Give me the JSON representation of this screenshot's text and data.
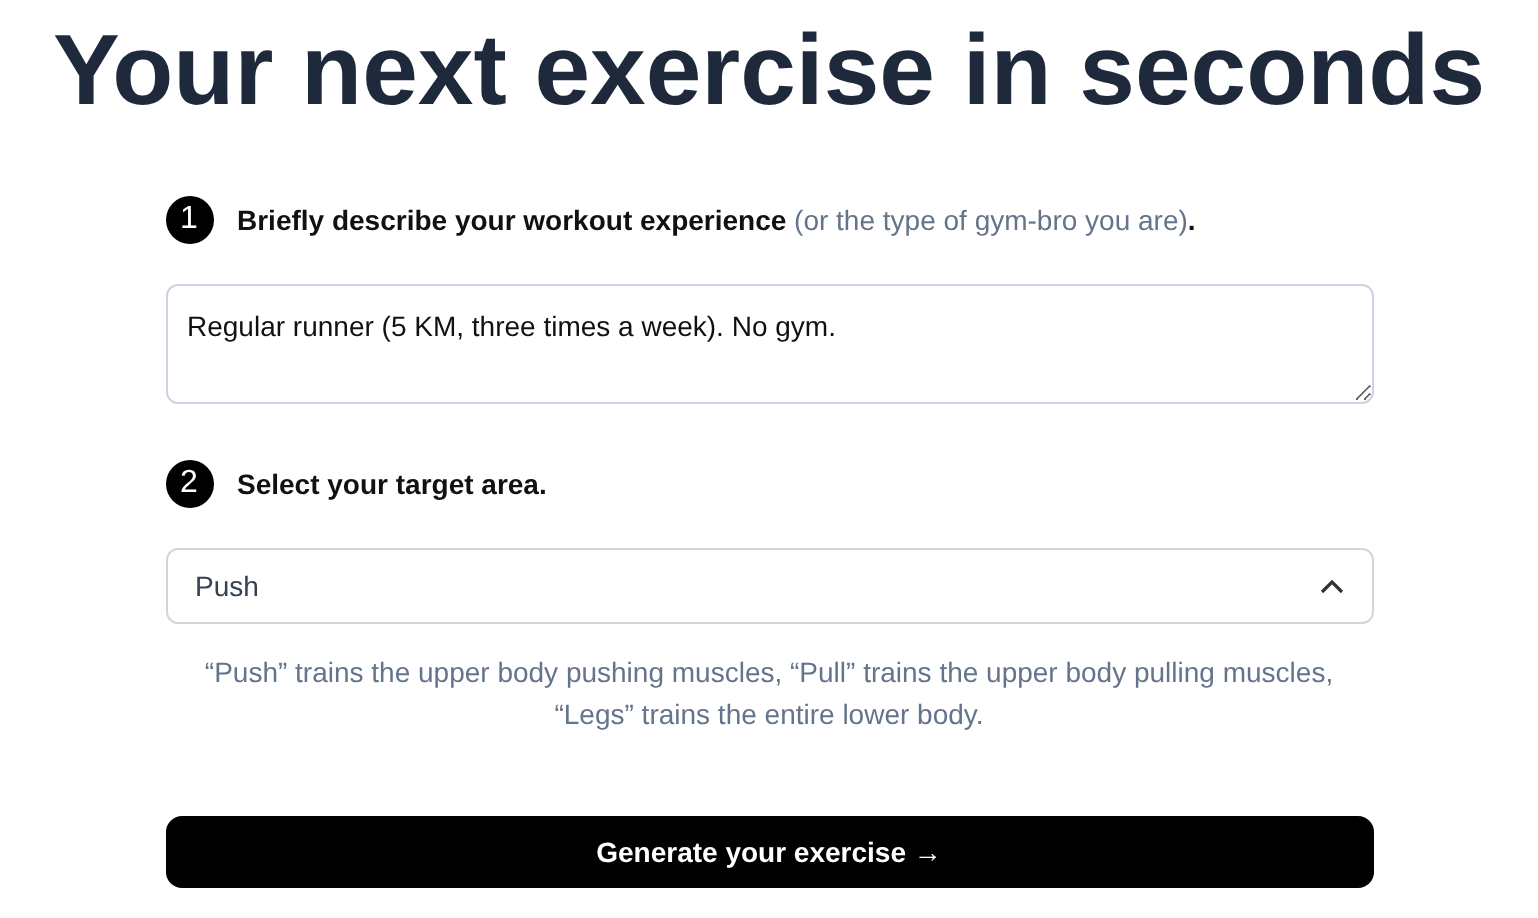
{
  "title": "Your next exercise in seconds",
  "steps": [
    {
      "number": "1",
      "label": "Briefly describe your workout experience",
      "hint": "(or the type of gym-bro you are)",
      "suffix": ".",
      "kind": "textarea",
      "value": "Regular runner (5 KM, three times a week). No gym."
    },
    {
      "number": "2",
      "label": "Select your target area.",
      "kind": "select",
      "value": "Push",
      "help": "“Push” trains the upper body pushing muscles, “Pull” trains the upper body pulling muscles, “Legs” trains the entire lower body."
    }
  ],
  "button": "Generate your exercise →"
}
